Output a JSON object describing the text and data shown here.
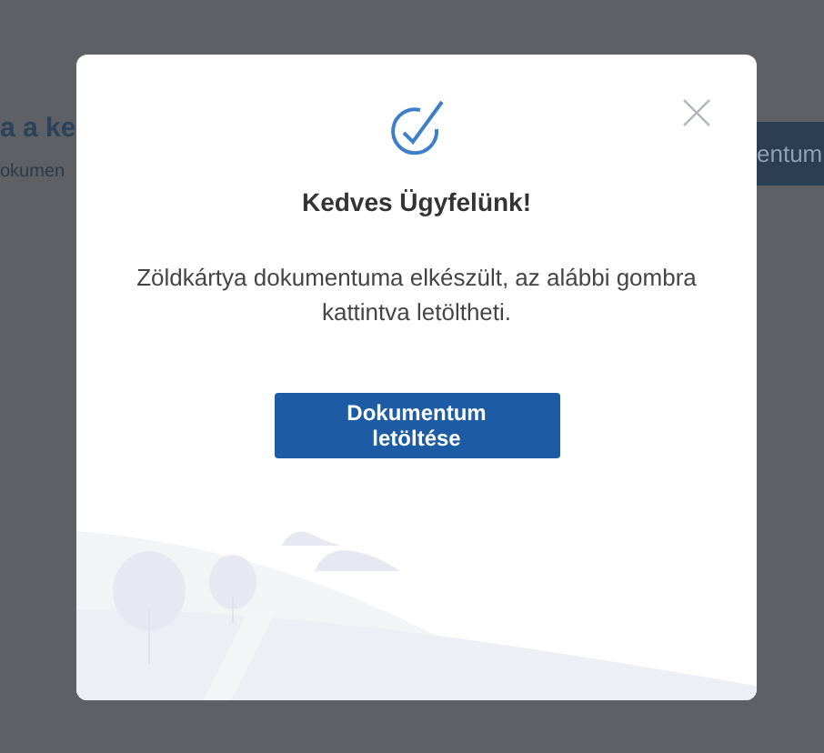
{
  "background_page": {
    "title": "a a ke",
    "subtitle": "okumen",
    "button": "entum"
  },
  "dialog": {
    "title": "Kedves Ügyfelünk!",
    "message": "Zöldkártya dokumentuma elkészült, az alábbi gombra kattintva letöltheti.",
    "button": "Dokumentum letöltése"
  }
}
